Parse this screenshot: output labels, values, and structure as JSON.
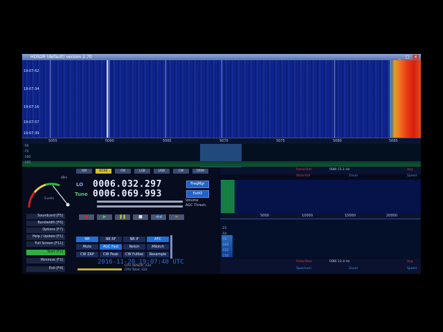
{
  "window": {
    "title": "HDSDR (default)  version 2.70"
  },
  "waterfall": {
    "times": [
      "19:07:52",
      "19:07:34",
      "19:07:16",
      "19:07:57",
      "19:07:39"
    ],
    "freq_labels": [
      "5055",
      "5060",
      "5065",
      "5070",
      "5075",
      "5080",
      "5085"
    ]
  },
  "spectrum": {
    "db_labels": [
      "-50",
      "-75",
      "-100",
      "-125"
    ]
  },
  "modes": [
    "AM",
    "ECSS",
    "FM",
    "LSB",
    "USB",
    "CW",
    "DRM"
  ],
  "meter": {
    "scale": "S-units",
    "scale2": "dBm"
  },
  "lo": {
    "label": "LO",
    "value": "0006.032.297"
  },
  "tune": {
    "label": "Tune",
    "value": "0006.069.993"
  },
  "buttons": {
    "freqmgr": "FreqMgr",
    "extio": "ExtIO"
  },
  "labels": {
    "volume": "Volume",
    "agc": "AGC Thresh."
  },
  "menu": [
    "Soundcard  [F5]",
    "Bandwidth  [F6]",
    "Options  [F7]",
    "Help / Update  [F1]",
    "Full Screen  [F11]",
    "Start  [F2]",
    "Minimize  [F3]",
    "Exit  [F4]"
  ],
  "dsp": {
    "row1": [
      "NR",
      "NB RF",
      "NB IF",
      "AFC"
    ],
    "row2": [
      "Mute",
      "AGC Fast",
      "Notch",
      "ANotch"
    ],
    "row3": [
      "CW ZAP",
      "CW Peak",
      "CW Fullbw",
      "Resample"
    ]
  },
  "datetime": "2016-11-20  19:07:40 UTC",
  "cpu": [
    "CPU HDSDR:  234",
    "CPU Total:  333"
  ],
  "right_top": {
    "ratio": "Ratio/Stat",
    "rbw": "RBW  15.1 Hz",
    "avg": "Avg",
    "waterfall": "Waterfall",
    "zoom": "Zoom",
    "speed": "Speed"
  },
  "right_bot": {
    "ratio": "Ratio/Stat",
    "rbw": "RBW  23.4 Hz",
    "avg": "Avg",
    "spectrum": "Spectrum",
    "zoom": "Zoom",
    "speed": "Speed"
  },
  "zoom_axis": [
    "5000",
    "10000",
    "15000",
    "20000"
  ],
  "zoom_db": [
    "-25",
    "-50",
    "-75",
    "-100",
    "-125",
    "-150"
  ]
}
